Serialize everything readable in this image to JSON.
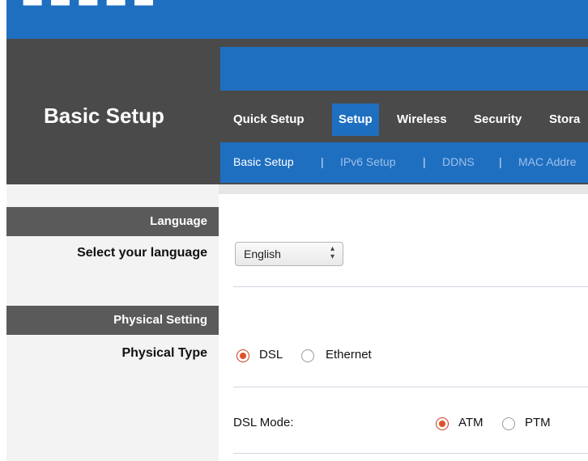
{
  "header": {
    "page_title": "Basic Setup"
  },
  "tabs": [
    {
      "label": "Quick Setup",
      "active": false
    },
    {
      "label": "Setup",
      "active": true
    },
    {
      "label": "Wireless",
      "active": false
    },
    {
      "label": "Security",
      "active": false
    },
    {
      "label": "Stora",
      "active": false
    }
  ],
  "subnav": {
    "items": [
      {
        "label": "Basic Setup",
        "active": true
      },
      {
        "label": "IPv6 Setup",
        "active": false
      },
      {
        "label": "DDNS",
        "active": false
      },
      {
        "label": "MAC Addre",
        "active": false
      }
    ],
    "separator": "|"
  },
  "sections": {
    "language": {
      "title": "Language",
      "label": "Select your language",
      "selected": "English"
    },
    "physical": {
      "title": "Physical Setting",
      "label": "Physical Type",
      "options": [
        {
          "label": "DSL",
          "checked": true
        },
        {
          "label": "Ethernet",
          "checked": false
        }
      ]
    },
    "dsl_mode": {
      "label": "DSL Mode:",
      "options": [
        {
          "label": "ATM",
          "checked": true
        },
        {
          "label": "PTM",
          "checked": false
        }
      ]
    }
  },
  "colors": {
    "brand_blue": "#1f6fc1",
    "header_dark": "#4a4a4a",
    "section_bar": "#5a5a5a",
    "radio_selected": "#e0522c"
  },
  "icons": {
    "select_arrow": "updown-arrows-icon"
  }
}
